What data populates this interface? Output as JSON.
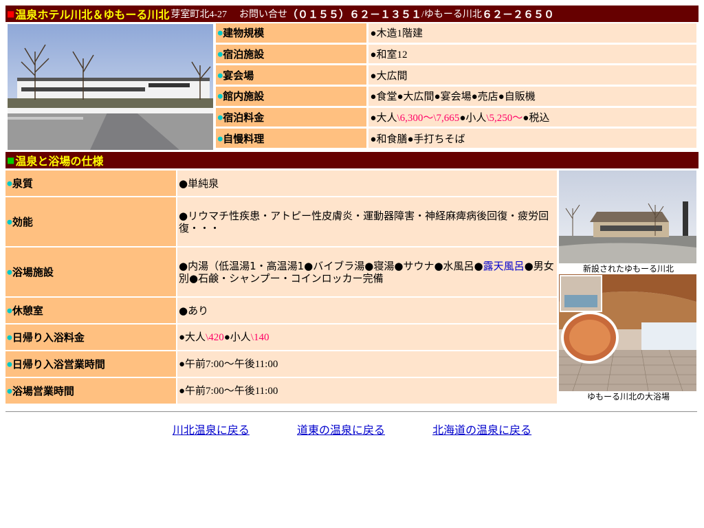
{
  "header": {
    "title": "温泉ホテル川北＆ゆもーる川北",
    "address": "芽室町北4-27",
    "inquiry_label": "お問い合せ",
    "tel": "（０１５５）６２－１３５１",
    "tel2_prefix": "/ゆもーる川北",
    "tel2": "６２－２６５０"
  },
  "facility": [
    {
      "label": "建物規模",
      "value": "●木造1階建"
    },
    {
      "label": "宿泊施設",
      "value": "●和室12"
    },
    {
      "label": "宴会場",
      "value": "●大広間"
    },
    {
      "label": "館内施設",
      "value": "●食堂●大広間●宴会場●売店●自販機"
    },
    {
      "label": "宿泊料金",
      "value_parts": [
        "●大人",
        "\\6,300～\\7,665",
        "●小人",
        "\\5,250～",
        "●税込"
      ]
    },
    {
      "label": "自慢料理",
      "value": "●和食膳●手打ちそば"
    }
  ],
  "spec_header": "温泉と浴場の仕様",
  "spec": [
    {
      "label": "泉質",
      "value": "●単純泉"
    },
    {
      "label": "効能",
      "value": "●リウマチ性疾患・アトピー性皮膚炎・運動器障害・神経麻痺病後回復・疲労回復・・・"
    },
    {
      "label": "浴場施設",
      "value_parts": [
        "●内湯（低温湯1・高温湯1●バイブラ湯●寝湯●サウナ●水風呂●",
        "露天風呂",
        "●男女別●石鹸・シャンプー・コインロッカー完備"
      ]
    },
    {
      "label": "休憩室",
      "value": "●あり"
    },
    {
      "label": "日帰り入浴料金",
      "value_parts": [
        "●大人",
        "\\420",
        "●小人",
        "\\140"
      ]
    },
    {
      "label": "日帰り入浴営業時間",
      "value": "●午前7:00～午後11:00"
    },
    {
      "label": "浴場営業時間",
      "value": "●午前7:00～午後11:00"
    }
  ],
  "photos": {
    "caption1": "新設されたゆもーる川北",
    "caption2": "ゆもーる川北の大浴場",
    "sign_text": "温泉ホテル川北"
  },
  "links": [
    {
      "label": "川北温泉に戻る"
    },
    {
      "label": "道東の温泉に戻る"
    },
    {
      "label": "北海道の温泉に戻る"
    }
  ],
  "colors": {
    "bar_bg": "#660000",
    "title": "#ffff00",
    "label_bg": "#ffc080",
    "value_bg": "#ffe4cc",
    "price": "#ff0066",
    "link": "#0000cc"
  }
}
